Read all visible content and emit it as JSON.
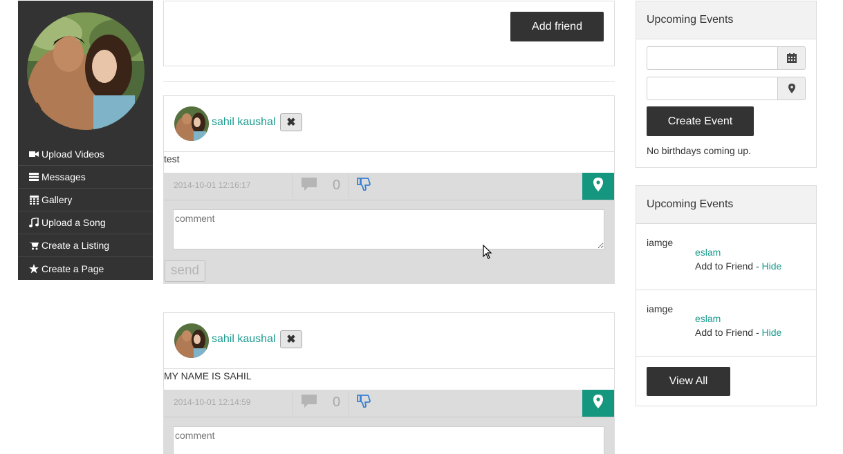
{
  "sidebar": {
    "menu": [
      {
        "label": "Upload Videos",
        "icon": "video-camera-icon"
      },
      {
        "label": "Messages",
        "icon": "inbox-icon"
      },
      {
        "label": "Gallery",
        "icon": "calendar-grid-icon"
      },
      {
        "label": "Upload a Song",
        "icon": "music-note-icon"
      },
      {
        "label": "Create a Listing",
        "icon": "shopping-cart-icon"
      },
      {
        "label": "Create a Page",
        "icon": "star-icon"
      }
    ]
  },
  "profile": {
    "add_friend_label": "Add friend"
  },
  "posts": [
    {
      "author": "sahil kaushal",
      "remove_symbol": "✖",
      "text": "test",
      "date": "2014-10-01 12:16:17",
      "comment_count": "0",
      "comment_placeholder": "comment",
      "send_label": "send"
    },
    {
      "author": "sahil kaushal",
      "remove_symbol": "✖",
      "text": "MY NAME IS SAHIL",
      "date": "2014-10-01 12:14:59",
      "comment_count": "0",
      "comment_placeholder": "comment"
    }
  ],
  "events_panel": {
    "title": "Upcoming Events",
    "create_label": "Create Event",
    "no_birthdays": "No birthdays coming up."
  },
  "friends_panel": {
    "title": "Upcoming Events",
    "suggestions": [
      {
        "image_alt": "iamge",
        "name": "eslam",
        "action": "Add to Friend - ",
        "hide": "Hide"
      },
      {
        "image_alt": "iamge",
        "name": "eslam",
        "action": "Add to Friend - ",
        "hide": "Hide"
      }
    ],
    "view_all_label": "View All"
  },
  "colors": {
    "sidebar_bg": "#333333",
    "accent_teal": "#15967f",
    "link_teal": "#1a9b8e",
    "meta_bar": "#dcdcdc"
  }
}
